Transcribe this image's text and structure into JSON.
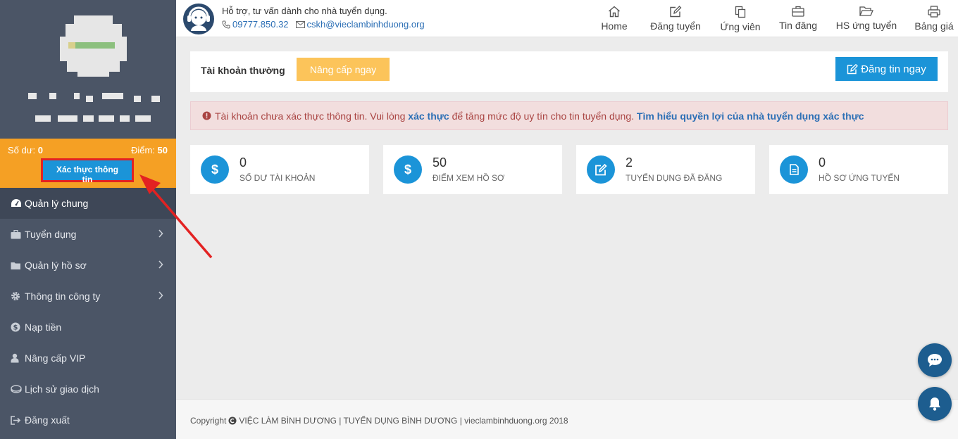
{
  "sidebar": {
    "balance_label": "Số dư:",
    "balance_value": "0",
    "points_label": "Điểm:",
    "points_value": "50",
    "verify_button": "Xác thực thông tin",
    "menu": [
      {
        "label": "Quản lý chung",
        "icon": "dashboard-icon",
        "active": true
      },
      {
        "label": "Tuyển dụng",
        "icon": "briefcase-icon",
        "chevron": true
      },
      {
        "label": "Quản lý hồ sơ",
        "icon": "folder-icon",
        "chevron": true
      },
      {
        "label": "Thông tin công ty",
        "icon": "gear-icon",
        "chevron": true
      },
      {
        "label": "Nạp tiền",
        "icon": "dollar-icon"
      },
      {
        "label": "Nâng cấp VIP",
        "icon": "user-icon"
      },
      {
        "label": "Lịch sử giao dịch",
        "icon": "coins-icon"
      },
      {
        "label": "Đăng xuất",
        "icon": "logout-icon"
      }
    ]
  },
  "header": {
    "support_text": "Hỗ trợ, tư vấn dành cho nhà tuyển dụng.",
    "phone": "09777.850.32",
    "email": "cskh@vieclambinhduong.org",
    "nav": [
      {
        "label": "Home",
        "icon": "home-icon"
      },
      {
        "label": "Đăng tuyển",
        "icon": "edit-icon"
      },
      {
        "label": "Ứng viên",
        "icon": "copy-icon"
      },
      {
        "label": "Tin đăng",
        "icon": "briefcase-icon"
      },
      {
        "label": "HS ứng tuyển",
        "icon": "folder-open-icon"
      },
      {
        "label": "Bảng giá",
        "icon": "printer-icon"
      }
    ]
  },
  "main": {
    "account_type": "Tài khoản thường",
    "upgrade_button": "Nâng cấp ngay",
    "post_button": "Đăng tin ngay",
    "alert": {
      "part1": "Tài khoản chưa xác thực thông tin. Vui lòng",
      "link1": "xác thực",
      "part2": "để tăng mức độ uy tín cho tin tuyển dụng.",
      "link2": "Tìm hiểu quyền lợi của nhà tuyển dụng xác thực"
    },
    "stats": [
      {
        "value": "0",
        "label": "SỐ DƯ TÀI KHOẢN",
        "icon": "dollar-icon"
      },
      {
        "value": "50",
        "label": "ĐIỂM XEM HỒ SƠ",
        "icon": "dollar-icon"
      },
      {
        "value": "2",
        "label": "TUYỂN DỤNG ĐÃ ĐĂNG",
        "icon": "edit-icon"
      },
      {
        "value": "0",
        "label": "HỒ SƠ ỨNG TUYỂN",
        "icon": "document-icon"
      }
    ]
  },
  "footer": {
    "copyright_label": "Copyright",
    "text": "VIỆC LÀM BÌNH DƯƠNG | TUYỂN DỤNG BÌNH DƯƠNG | vieclambinhduong.org 2018"
  },
  "colors": {
    "sidebar_bg": "#4b5566",
    "balance_bg": "#f5a024",
    "primary": "#1b94d8",
    "upgrade": "#fcc45a",
    "alert_bg": "#f2dede",
    "fab": "#1d5d8f"
  }
}
